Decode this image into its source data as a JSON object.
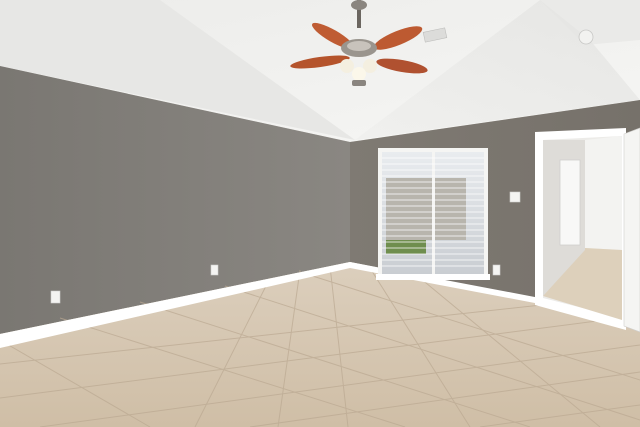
{
  "colors": {
    "wall": "#7b7873",
    "ceiling": "#f1f1ef",
    "floor_tile": "#d9c9b2",
    "trim": "#ffffff",
    "fan_blade": "#b5542c"
  },
  "objects": {
    "ceiling_fan": "ceiling-fan-icon",
    "window": "window-blinds",
    "doorway": "open-doorway"
  }
}
